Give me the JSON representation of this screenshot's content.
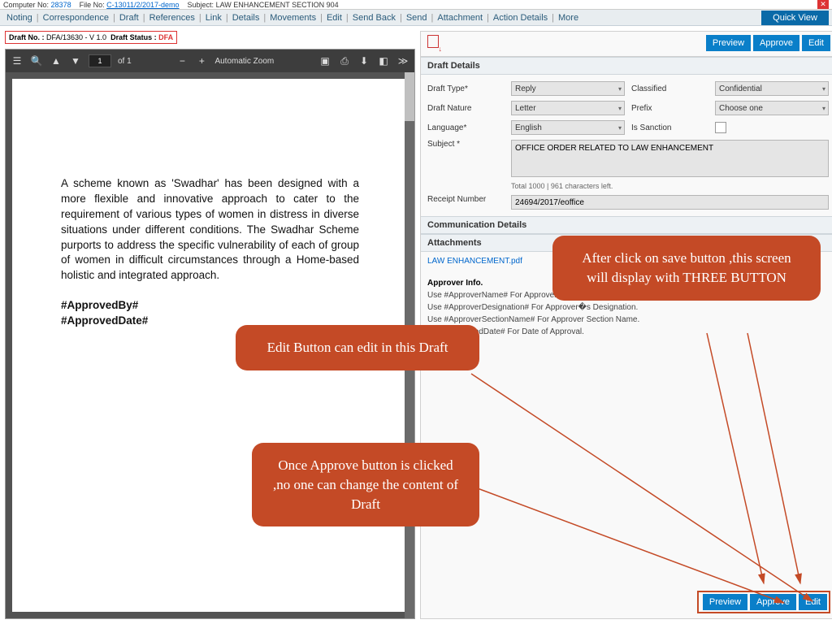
{
  "topbar": {
    "computer_no_label": "Computer No:",
    "computer_no": "28378",
    "file_no_label": "File No:",
    "file_no": "C-13011/2/2017-demo",
    "subject_label": "Subject:",
    "subject": "LAW ENHANCEMENT SECTION 904"
  },
  "menu": {
    "items": [
      "Noting",
      "Correspondence",
      "Draft",
      "References",
      "Link",
      "Details",
      "Movements",
      "Edit",
      "Send Back",
      "Send",
      "Attachment",
      "Action Details",
      "More"
    ],
    "quick_view": "Quick View"
  },
  "draft_status": {
    "no_label": "Draft No. :",
    "no": "DFA/13630 - V 1.0",
    "status_label": "Draft Status :",
    "status": "DFA"
  },
  "pdf": {
    "page_current": "1",
    "page_total": "of 1",
    "zoom": "Automatic Zoom",
    "body_text": "A scheme known as 'Swadhar' has been designed with a more flexible and innovative approach to cater to the requirement of various types of women in distress in diverse situations under different conditions. The Swadhar Scheme purports to address the specific vulnerability of each of group of women in difficult circumstances through a Home-based holistic and integrated approach.",
    "ph1": "#ApprovedBy#",
    "ph2": "#ApprovedDate#"
  },
  "right": {
    "preview": "Preview",
    "approve": "Approve",
    "edit": "Edit",
    "sections": {
      "draft_details": "Draft Details",
      "comm_details": "Communication Details",
      "attachments": "Attachments"
    },
    "form": {
      "draft_type_l": "Draft Type*",
      "draft_type_v": "Reply",
      "classified_l": "Classified",
      "classified_v": "Confidential",
      "draft_nature_l": "Draft Nature",
      "draft_nature_v": "Letter",
      "prefix_l": "Prefix",
      "prefix_v": "Choose one",
      "language_l": "Language*",
      "language_v": "English",
      "sanction_l": "Is Sanction",
      "subject_l": "Subject *",
      "subject_v": "OFFICE ORDER RELATED TO LAW ENHANCEMENT",
      "char_count": "Total 1000 |   961     characters left.",
      "receipt_l": "Receipt Number",
      "receipt_v": "24694/2017/eoffice"
    },
    "attachment_link": "LAW ENHANCEMENT.pdf",
    "approver": {
      "heading": "Approver Info.",
      "l1": "Use #ApproverName# For Approver�s Name",
      "l2": "Use #ApproverDesignation# For Approver�s Designation.",
      "l3": "Use #ApproverSectionName# For Approver Section Name.",
      "l4": "Use #ApprovedDate# For Date of Approval."
    }
  },
  "callouts": {
    "c1": "Edit Button can edit in this Draft",
    "c2": "Once Approve button is clicked ,no one can change the content of Draft",
    "c3": "After click on save button ,this screen will display with THREE BUTTON"
  }
}
